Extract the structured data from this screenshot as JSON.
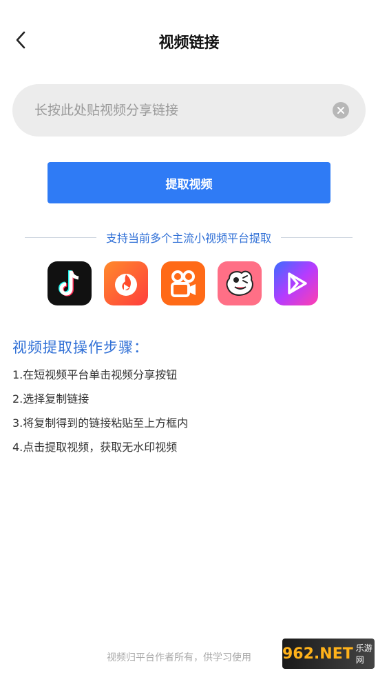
{
  "header": {
    "title": "视频链接",
    "back_icon": "chevron-left-icon"
  },
  "search": {
    "placeholder": "长按此处贴视频分享链接",
    "value": "",
    "clear_icon": "clear-circle-icon"
  },
  "extract_button": {
    "label": "提取视频",
    "color": "#2f7bf5"
  },
  "support": {
    "text": "支持当前多个主流小视频平台提取",
    "color": "#2f6fd6"
  },
  "platforms": [
    {
      "name": "tiktok-icon"
    },
    {
      "name": "huoshan-icon"
    },
    {
      "name": "kuaishou-icon"
    },
    {
      "name": "pipixia-icon"
    },
    {
      "name": "weishi-icon"
    }
  ],
  "steps": {
    "title": "视频提取操作步骤：",
    "items": [
      "1.在短视频平台单击视频分享按钮",
      "2.选择复制链接",
      "3.将复制得到的链接粘贴至上方框内",
      "4.点击提取视频，获取无水印视频"
    ]
  },
  "footer": {
    "text": "视频归平台作者所有，供学习使用"
  },
  "watermark": {
    "main": "962.NET",
    "sub": "乐游网"
  }
}
